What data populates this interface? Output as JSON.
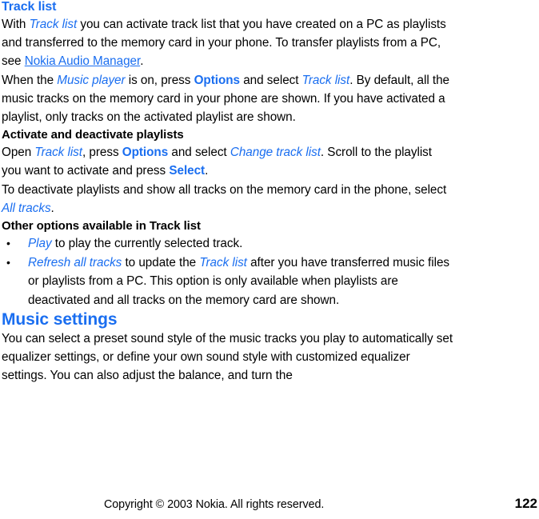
{
  "document": {
    "title": "Track list",
    "page_number": "122",
    "copyright": "Copyright © 2003 Nokia. All rights reserved."
  },
  "colors": {
    "accent_blue": "#1a6ef0",
    "body_text": "#000000",
    "background": "#ffffff"
  },
  "sections": {
    "track_list": {
      "heading": "Track list",
      "para1": {
        "t1": "With ",
        "ui1": "Track list",
        "t2": " you can activate track list that you have created on a PC as playlists and transferred to the memory card in your phone. To transfer playlists from a PC, see ",
        "link1": "Nokia Audio Manager",
        "t3": "."
      },
      "para2": {
        "t1": "When the ",
        "ui1": "Music player",
        "t2": " is on, press ",
        "cmd1": "Options",
        "t3": " and select ",
        "ui2": "Track list",
        "t4": ". By default, all the music tracks on the memory card in your phone are shown. If you have activated a playlist, only tracks on the activated playlist are shown."
      }
    },
    "activate_deactivate": {
      "heading": "Activate and deactivate playlists",
      "para1": {
        "t1": "Open ",
        "ui1": "Track list",
        "t2": ", press ",
        "cmd1": "Options",
        "t3": " and select ",
        "ui2": "Change track list",
        "t4": ". Scroll to the playlist you want to activate and press ",
        "cmd2": "Select",
        "t5": "."
      },
      "para2": {
        "t1": "To deactivate playlists and show all tracks on the memory card in the phone, select ",
        "ui1": "All tracks",
        "t2": "."
      }
    },
    "other_options": {
      "heading": "Other options available in Track list",
      "bullets": [
        {
          "marker": "•",
          "ui1": "Play",
          "t1": " to play the currently selected track."
        },
        {
          "marker": "•",
          "ui1": "Refresh all tracks",
          "t1": " to update the ",
          "ui2": "Track list",
          "t2": " after you have transferred music files or playlists from a PC. This option is only available when playlists are deactivated and all tracks on the memory card are shown."
        }
      ]
    },
    "music_settings": {
      "heading": "Music settings",
      "para1": {
        "t1": "You can select a preset sound style of the music tracks you play to automatically set equalizer settings, or define your own sound style with customized equalizer settings. You can also adjust the balance, and turn the"
      }
    }
  }
}
